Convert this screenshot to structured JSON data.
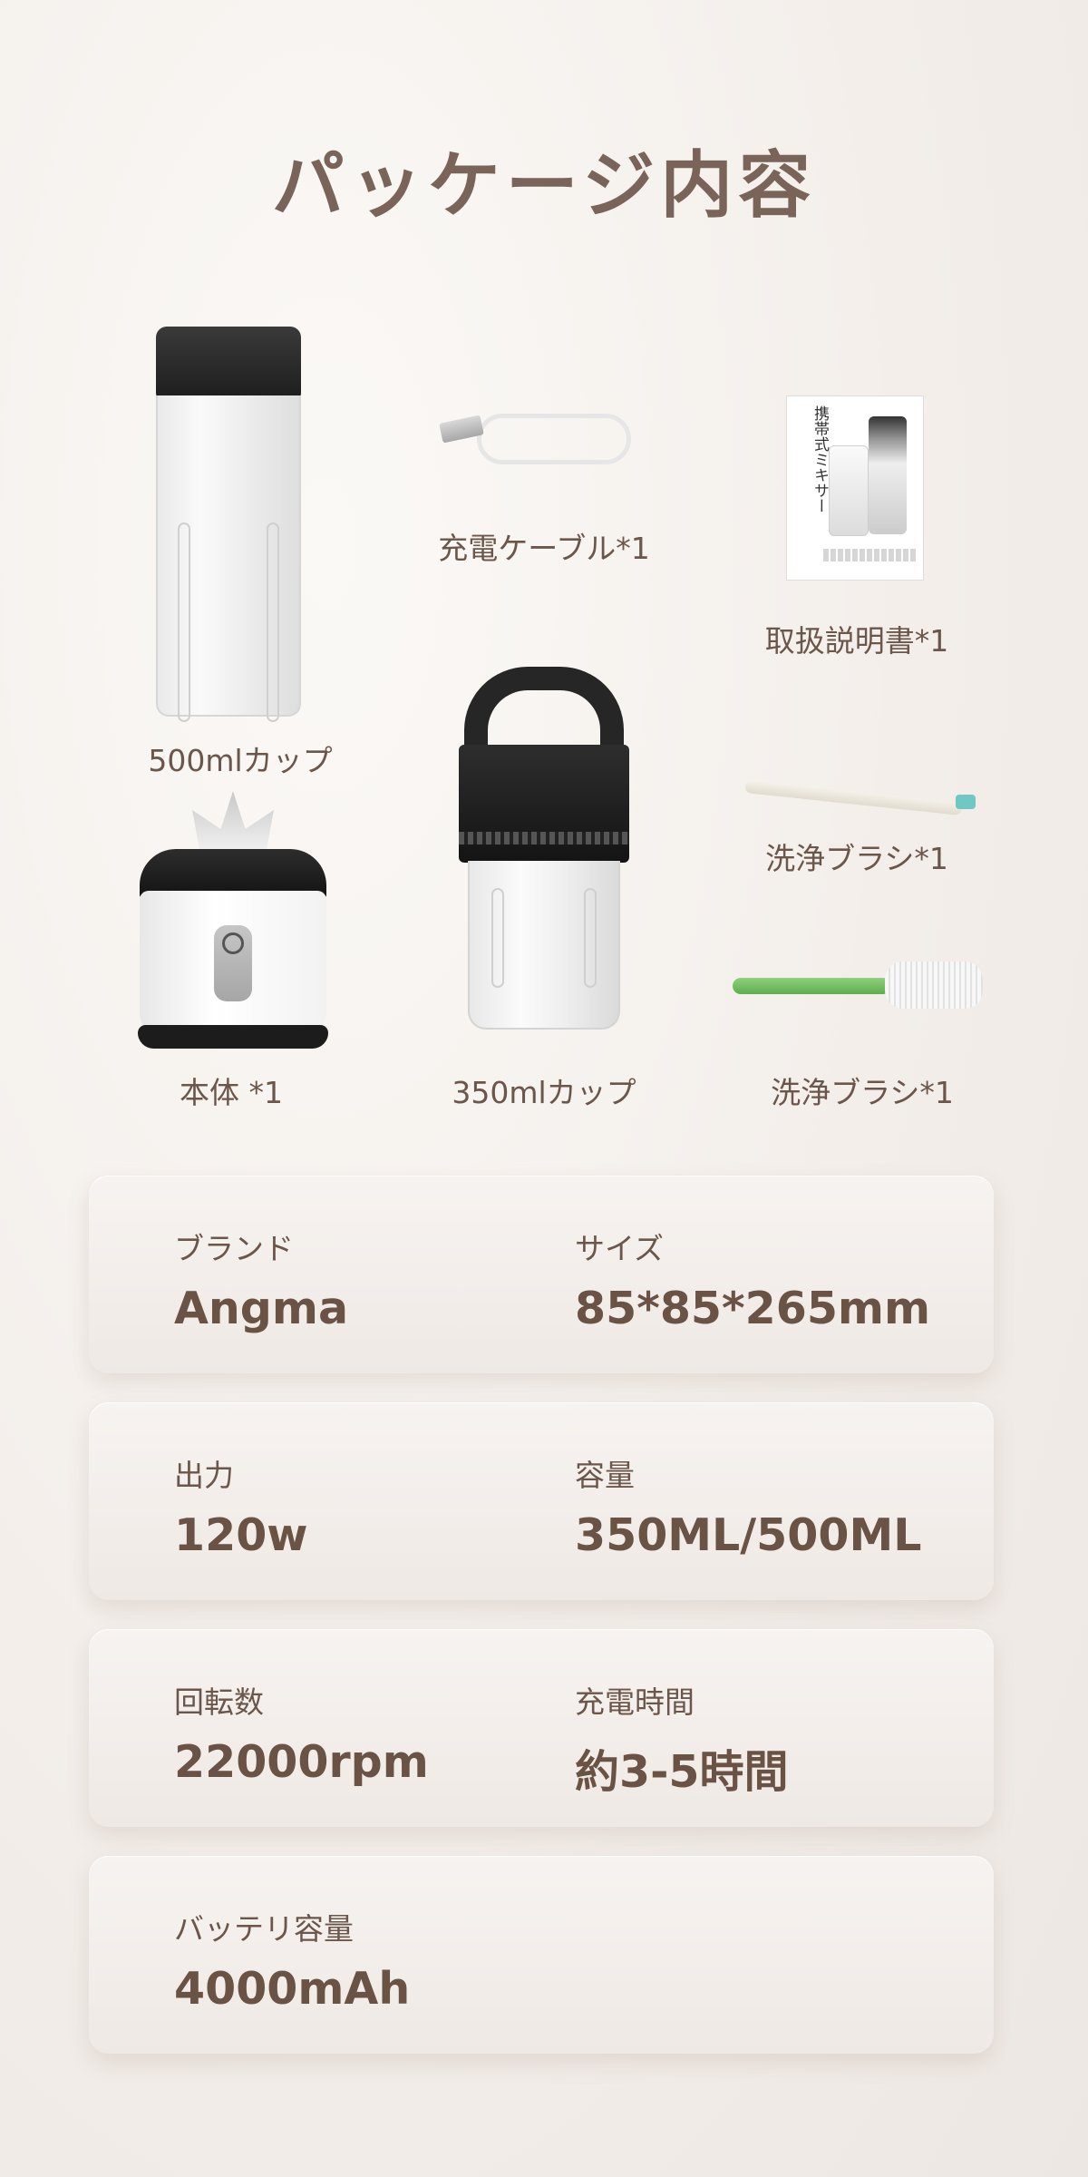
{
  "title": "パッケージ内容",
  "items": {
    "cup500": "500mlカップ",
    "cable": "充電ケーブル*1",
    "manual": "取扱説明書*1",
    "manual_cover_title": "携帯式ミキサー",
    "base": "本体 *1",
    "cup350": "350mlカップ",
    "brush1": "洗浄ブラシ*1",
    "brush2": "洗浄ブラシ*1"
  },
  "specs": [
    {
      "label_left": "ブランド",
      "value_left": "Angma",
      "label_right": "サイズ",
      "value_right": "85*85*265mm"
    },
    {
      "label_left": "出力",
      "value_left": "120w",
      "label_right": "容量",
      "value_right": "350ML/500ML"
    },
    {
      "label_left": "回転数",
      "value_left": "22000rpm",
      "label_right": "充電時間",
      "value_right": "約3-5時間"
    },
    {
      "label_left": "バッテリ容量",
      "value_left": "4000mAh"
    }
  ]
}
